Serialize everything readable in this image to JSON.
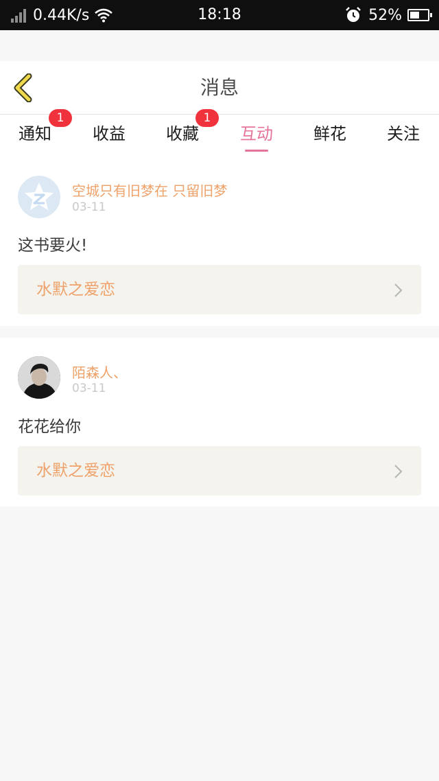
{
  "status_bar": {
    "speed": "0.44K/s",
    "time": "18:18",
    "battery": "52%",
    "battery_level": 0.52
  },
  "header": {
    "title": "消息",
    "back_icon": "back-chevron-icon"
  },
  "tabs": [
    {
      "label": "通知",
      "badge": "1"
    },
    {
      "label": "收益"
    },
    {
      "label": "收藏",
      "badge": "1"
    },
    {
      "label": "互动",
      "active": true
    },
    {
      "label": "鲜花"
    },
    {
      "label": "关注"
    }
  ],
  "colors": {
    "accent": "#e6739c",
    "username": "#eea26a",
    "badge": "#f0323c"
  },
  "messages": [
    {
      "username": "空城只有旧梦在 只留旧梦",
      "date": "03-11",
      "text": "这书要火!",
      "book": "水默之爱恋",
      "avatar_icon": "default-star-avatar-icon"
    },
    {
      "username": "陌森人、",
      "date": "03-11",
      "text": "花花给你",
      "book": "水默之爱恋",
      "avatar_icon": "user-photo-avatar"
    }
  ]
}
